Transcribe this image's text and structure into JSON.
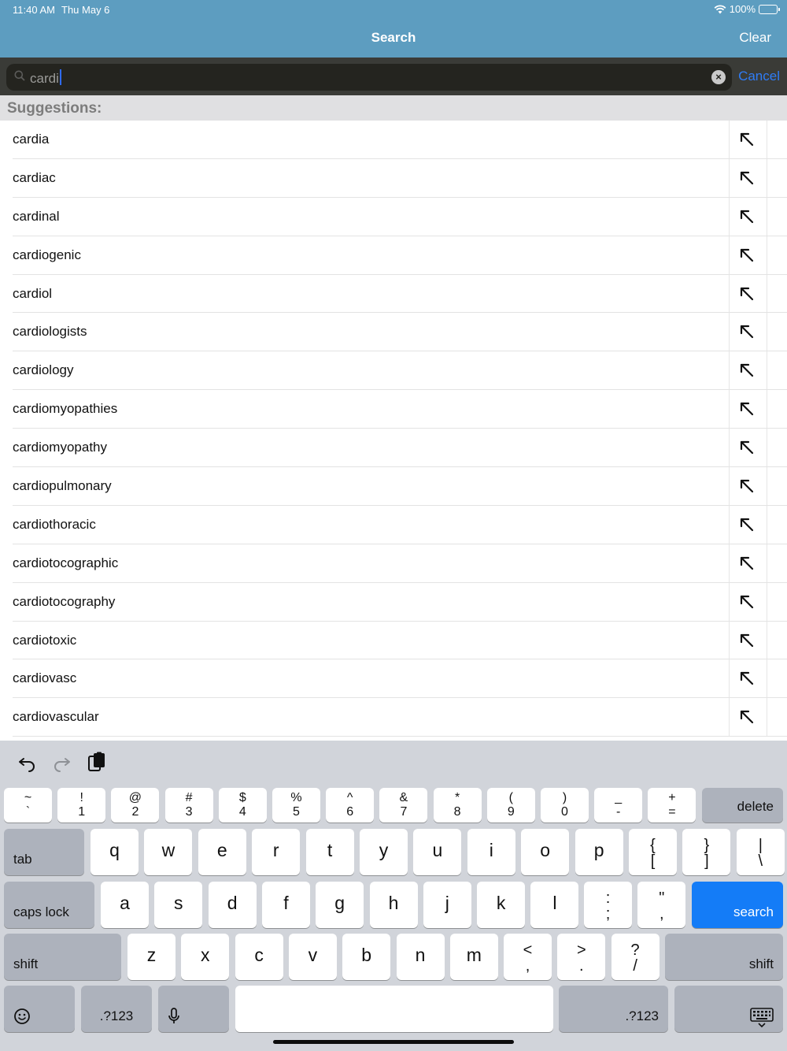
{
  "status_bar": {
    "time": "11:40 AM",
    "date": "Thu May 6",
    "battery": "100%"
  },
  "nav": {
    "title": "Search",
    "clear_label": "Clear"
  },
  "search": {
    "query": "cardi",
    "cancel_label": "Cancel"
  },
  "suggestions": {
    "header": "Suggestions:",
    "items": [
      "cardia",
      "cardiac",
      "cardinal",
      "cardiogenic",
      "cardiol",
      "cardiologists",
      "cardiology",
      "cardiomyopathies",
      "cardiomyopathy",
      "cardiopulmonary",
      "cardiothoracic",
      "cardiotocographic",
      "cardiotocography",
      "cardiotoxic",
      "cardiovasc",
      "cardiovascular"
    ]
  },
  "keyboard": {
    "number_row": [
      {
        "top": "~",
        "bot": "`"
      },
      {
        "top": "!",
        "bot": "1"
      },
      {
        "top": "@",
        "bot": "2"
      },
      {
        "top": "#",
        "bot": "3"
      },
      {
        "top": "$",
        "bot": "4"
      },
      {
        "top": "%",
        "bot": "5"
      },
      {
        "top": "^",
        "bot": "6"
      },
      {
        "top": "&",
        "bot": "7"
      },
      {
        "top": "*",
        "bot": "8"
      },
      {
        "top": "(",
        "bot": "9"
      },
      {
        "top": ")",
        "bot": "0"
      },
      {
        "top": "_",
        "bot": "-"
      },
      {
        "top": "+",
        "bot": "="
      }
    ],
    "delete_label": "delete",
    "tab_label": "tab",
    "row_q": [
      "q",
      "w",
      "e",
      "r",
      "t",
      "y",
      "u",
      "i",
      "o",
      "p"
    ],
    "row_q_symbols": [
      {
        "top": "{",
        "bot": "["
      },
      {
        "top": "}",
        "bot": "]"
      },
      {
        "top": "|",
        "bot": "\\"
      }
    ],
    "caps_label": "caps lock",
    "row_a": [
      "a",
      "s",
      "d",
      "f",
      "g",
      "h",
      "j",
      "k",
      "l"
    ],
    "row_a_symbols": [
      {
        "top": ":",
        "bot": ";"
      },
      {
        "top": "\"",
        "bot": ","
      }
    ],
    "search_label": "search",
    "shift_label": "shift",
    "row_z": [
      "z",
      "x",
      "c",
      "v",
      "b",
      "n",
      "m"
    ],
    "row_z_symbols": [
      {
        "top": "<",
        "bot": ","
      },
      {
        "top": ">",
        "bot": "."
      },
      {
        "top": "?",
        "bot": "/"
      }
    ],
    "numbers_label": ".?123"
  },
  "icons": {
    "search": "magnifier-icon",
    "clear": "clear-circle-icon",
    "fill": "arrow-up-left-icon",
    "undo": "undo-icon",
    "redo": "redo-icon",
    "paste": "clipboard-icon",
    "emoji": "emoji-icon",
    "mic": "microphone-icon",
    "hide_keyboard": "keyboard-dismiss-icon"
  },
  "colors": {
    "nav": "#5d9dc0",
    "accent": "#147cf7",
    "cancel": "#2f7cf6"
  }
}
